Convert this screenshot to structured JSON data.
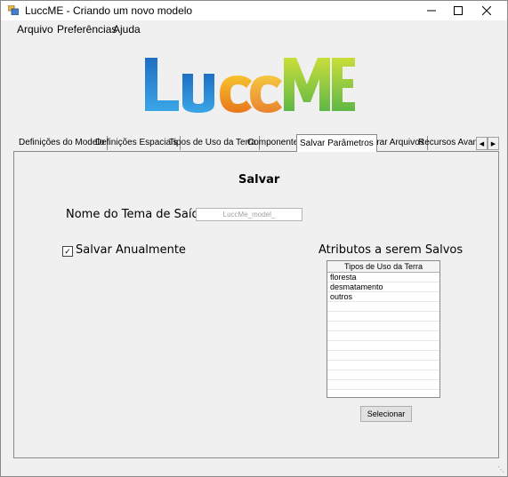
{
  "window": {
    "title": "LuccME - Criando um novo modelo",
    "minimize_icon": "minimize-icon",
    "maximize_icon": "maximize-icon",
    "close_icon": "close-icon"
  },
  "menu": [
    {
      "label": "Arquivo"
    },
    {
      "label": "Preferências"
    },
    {
      "label": "Ajuda"
    }
  ],
  "logo": {
    "text": "LuccME",
    "colors": {
      "L": "#2f8fd8",
      "u": "#3aa0e0",
      "cc": "#f0a21c",
      "M": "#8dc63f",
      "E": "#b7d72b"
    }
  },
  "tabs": [
    {
      "label": "Definições do Modelo",
      "active": false
    },
    {
      "label": "Definições Espaciais",
      "active": false
    },
    {
      "label": "Tipos de Uso da Terra",
      "active": false
    },
    {
      "label": "Componentes",
      "active": false
    },
    {
      "label": "Salvar Parâmetros",
      "active": true
    },
    {
      "label": "Gerar Arquivos",
      "active": false
    },
    {
      "label": "Recursos Avança",
      "active": false
    }
  ],
  "panel": {
    "heading": "Salvar",
    "output_theme_label": "Nome do Tema de Saída",
    "output_theme_value": "LuccMe_model_",
    "save_annually_label": "Salvar Anualmente",
    "save_annually_checked": true,
    "attributes_label": "Atributos a serem Salvos",
    "list_header": "Tipos de Uso da Terra",
    "list_items": [
      "floresta",
      "desmatamento",
      "outros"
    ],
    "select_button": "Selecionar"
  }
}
